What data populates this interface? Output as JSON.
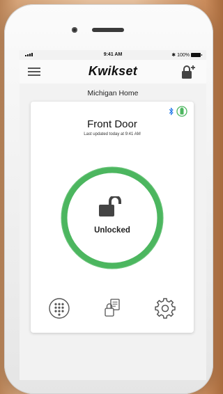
{
  "status_bar": {
    "time": "9:41 AM",
    "battery": "100%"
  },
  "header": {
    "brand": "Kwikset",
    "menu_icon": "hamburger-menu-icon",
    "add_icon": "add-user-lock-icon"
  },
  "home": {
    "name": "Michigan Home"
  },
  "lock": {
    "name": "Front Door",
    "last_updated": "Last updated today at 9:41 AM",
    "status": "Unlocked",
    "status_color": "#4cb65f",
    "connection_icon": "bluetooth-icon",
    "battery_icon": "battery-full-icon"
  },
  "bottom_actions": {
    "keypad_icon": "keypad-icon",
    "history_icon": "history-icon",
    "settings_icon": "settings-gear-icon"
  }
}
